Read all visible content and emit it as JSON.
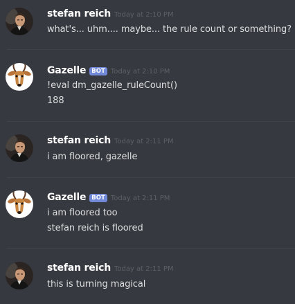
{
  "messages": [
    {
      "author": "stefan reich",
      "avatar_icon": "stefan-reich-avatar-icon",
      "timestamp": "Today at 2:10 PM",
      "is_bot": false,
      "lines": [
        "what's... uhm.... maybe... the rule count or something?"
      ]
    },
    {
      "author": "Gazelle",
      "avatar_icon": "gazelle-avatar-icon",
      "timestamp": "Today at 2:10 PM",
      "is_bot": true,
      "bot_label": "BOT",
      "lines": [
        "!eval dm_gazelle_ruleCount()",
        "188"
      ]
    },
    {
      "author": "stefan reich",
      "avatar_icon": "stefan-reich-avatar-icon",
      "timestamp": "Today at 2:11 PM",
      "is_bot": false,
      "lines": [
        "i am floored, gazelle"
      ]
    },
    {
      "author": "Gazelle",
      "avatar_icon": "gazelle-avatar-icon",
      "timestamp": "Today at 2:11 PM",
      "is_bot": true,
      "bot_label": "BOT",
      "lines": [
        "i am floored too",
        "stefan reich is floored"
      ]
    },
    {
      "author": "stefan reich",
      "avatar_icon": "stefan-reich-avatar-icon",
      "timestamp": "Today at 2:11 PM",
      "is_bot": false,
      "lines": [
        "this is turning magical"
      ]
    }
  ],
  "colors": {
    "background": "#36393f",
    "username": "#ffffff",
    "message_text": "#dcddde",
    "timestamp": "#5d6066",
    "bot_tag": "#7289da",
    "divider": "#40434a"
  }
}
